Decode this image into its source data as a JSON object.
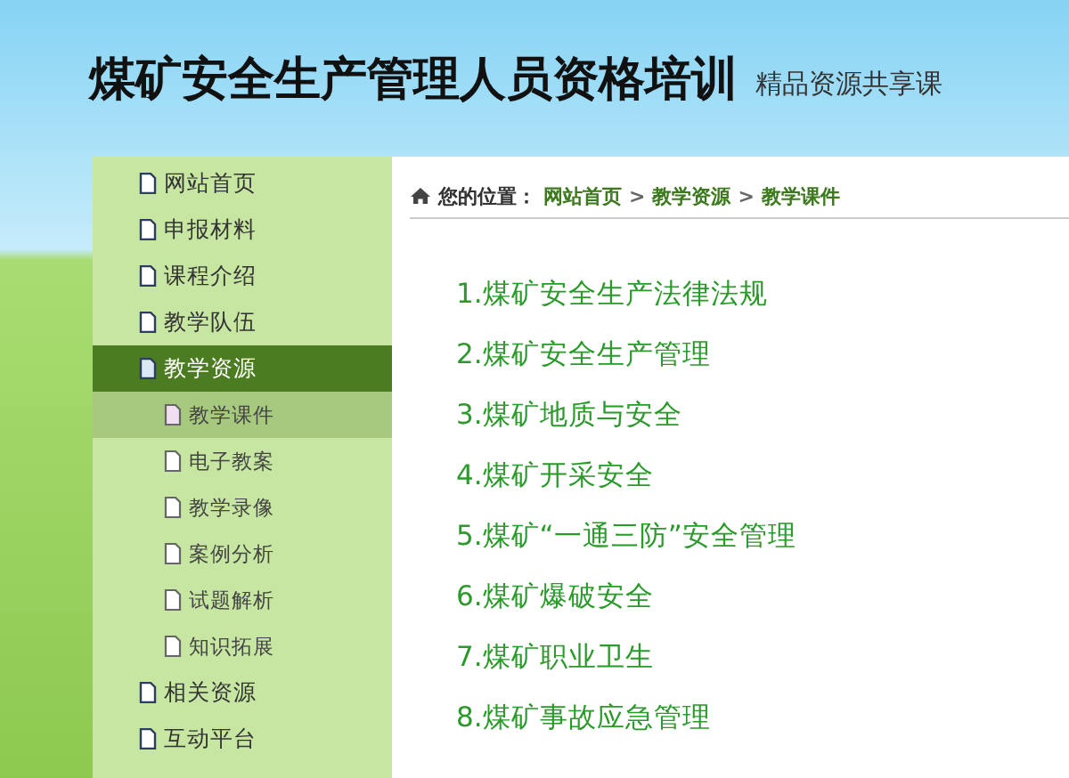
{
  "header": {
    "title": "煤矿安全生产管理人员资格培训",
    "subtitle": "精品资源共享课"
  },
  "sidebar": {
    "items": [
      {
        "label": "网站首页",
        "selected": false
      },
      {
        "label": "申报材料",
        "selected": false
      },
      {
        "label": "课程介绍",
        "selected": false
      },
      {
        "label": "教学队伍",
        "selected": false
      },
      {
        "label": "教学资源",
        "selected": true,
        "children": [
          {
            "label": "教学课件",
            "selected": true
          },
          {
            "label": "电子教案",
            "selected": false
          },
          {
            "label": "教学录像",
            "selected": false
          },
          {
            "label": "案例分析",
            "selected": false
          },
          {
            "label": "试题解析",
            "selected": false
          },
          {
            "label": "知识拓展",
            "selected": false
          }
        ]
      },
      {
        "label": "相关资源",
        "selected": false
      },
      {
        "label": "互动平台",
        "selected": false
      }
    ]
  },
  "breadcrumb": {
    "label": "您的位置：",
    "links": [
      "网站首页",
      "教学资源",
      "教学课件"
    ],
    "separator": ">"
  },
  "courses": [
    "1.煤矿安全生产法律法规",
    "2.煤矿安全生产管理",
    "3.煤矿地质与安全",
    "4.煤矿开采安全",
    "5.煤矿“一通三防”安全管理",
    "6.煤矿爆破安全",
    "7.煤矿职业卫生",
    "8.煤矿事故应急管理"
  ]
}
